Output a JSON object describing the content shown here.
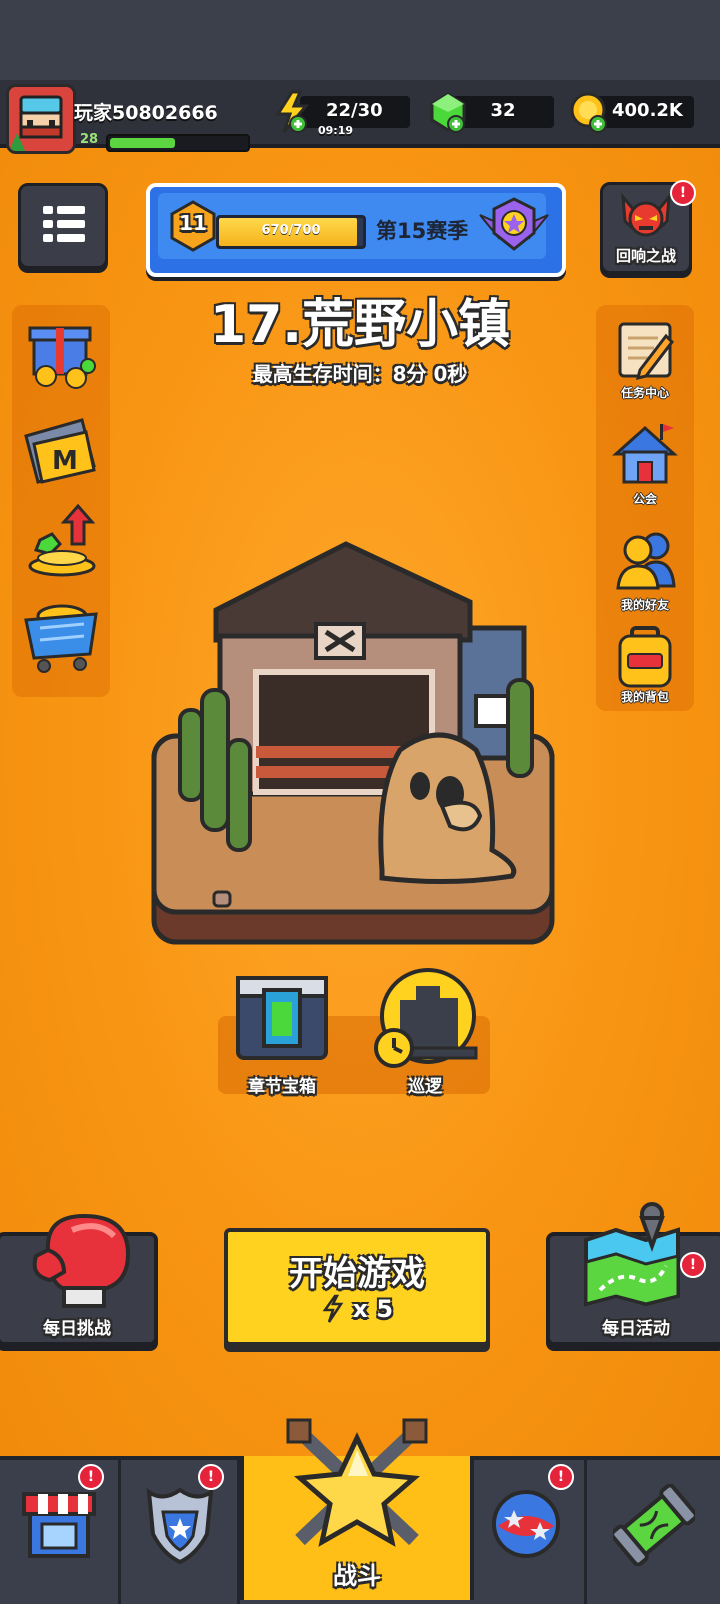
{
  "player": {
    "name": "玩家50802666",
    "level": "28",
    "xp_fraction": 0.48
  },
  "resources": {
    "energy": {
      "value": "22/30",
      "timer": "09:19",
      "icon": "lightning-icon"
    },
    "gems": {
      "value": "32",
      "icon": "green-gem-icon"
    },
    "coins": {
      "value": "400.2K",
      "icon": "gold-coin-icon"
    }
  },
  "season": {
    "level": "11",
    "progress": "670/700",
    "progress_fraction": 0.957,
    "label": "第15赛季"
  },
  "echo_battle": {
    "label": "回响之战",
    "badge": "!"
  },
  "chapter": {
    "title": "17.荒野小镇",
    "best_time": "最高生存时间：8分 0秒"
  },
  "left_menu": [
    {
      "name": "gift-icon"
    },
    {
      "name": "monthly-card-icon",
      "glyph": "M"
    },
    {
      "name": "growth-fund-icon"
    },
    {
      "name": "shop-cart-icon"
    }
  ],
  "right_menu": [
    {
      "label": "任务中心",
      "icon": "quest-scroll-icon"
    },
    {
      "label": "公会",
      "icon": "guild-house-icon"
    },
    {
      "label": "我的好友",
      "icon": "friends-icon"
    },
    {
      "label": "我的背包",
      "icon": "backpack-icon"
    }
  ],
  "chest": {
    "label": "章节宝箱"
  },
  "patrol": {
    "label": "巡逻"
  },
  "daily_challenge": {
    "label": "每日挑战"
  },
  "daily_activity": {
    "label": "每日活动",
    "badge": "!"
  },
  "start_game": {
    "label": "开始游戏",
    "cost": "x 5"
  },
  "nav": {
    "shop_badge": "!",
    "equip_badge": "!",
    "battle_label": "战斗",
    "talent_badge": "!"
  },
  "colors": {
    "background": "#f79a12",
    "topbar": "#2f323b",
    "season_blue": "#2c72e6",
    "start_yellow": "#ffd21f",
    "badge_red": "#e5233b"
  }
}
